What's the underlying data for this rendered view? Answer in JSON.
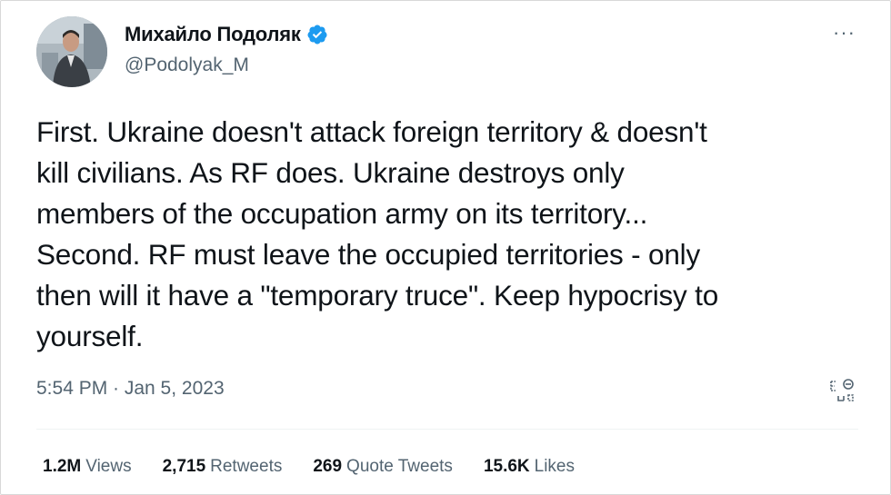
{
  "author": {
    "name": "Михайло Подоляк",
    "handle": "@Podolyak_M"
  },
  "tweet": {
    "text": "First. Ukraine doesn't attack foreign territory & doesn't\nkill civilians. As RF does. Ukraine destroys only\nmembers of the occupation army on its territory...\nSecond. RF must leave the occupied territories - only\nthen will it have a \"temporary truce\". Keep hypocrisy to\nyourself.",
    "timestamp": "5:54 PM · Jan 5, 2023"
  },
  "stats": {
    "views": {
      "count": "1.2M",
      "label": "Views"
    },
    "retweets": {
      "count": "2,715",
      "label": "Retweets"
    },
    "quotes": {
      "count": "269",
      "label": "Quote Tweets"
    },
    "likes": {
      "count": "15.6K",
      "label": "Likes"
    }
  },
  "icons": {
    "more": "more-horizontal-icon",
    "verified": "verified-badge-icon",
    "translate": "translate-icon"
  },
  "colors": {
    "verified": "#1d9bf0",
    "secondary_text": "#536471",
    "primary_text": "#0f1419"
  }
}
